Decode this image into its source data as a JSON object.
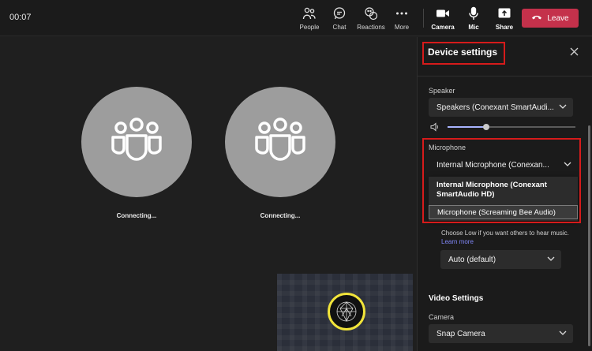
{
  "topbar": {
    "timer": "00:07",
    "people_label": "People",
    "chat_label": "Chat",
    "reactions_label": "Reactions",
    "more_label": "More",
    "camera_label": "Camera",
    "mic_label": "Mic",
    "share_label": "Share",
    "leave_label": "Leave"
  },
  "stage": {
    "participants": [
      {
        "status": "Connecting..."
      },
      {
        "status": "Connecting..."
      }
    ]
  },
  "panel": {
    "title": "Device settings",
    "speaker_label": "Speaker",
    "speaker_value": "Speakers (Conexant SmartAudi...",
    "volume_level_percent": 30,
    "microphone_label": "Microphone",
    "microphone_value": "Internal Microphone (Conexan...",
    "mic_options": [
      "Internal Microphone (Conexant SmartAudio HD)",
      "Microphone (Screaming Bee Audio)"
    ],
    "noise_note": "Choose Low if you want others to hear music.",
    "learn_more": "Learn more",
    "noise_value": "Auto (default)",
    "video_heading": "Video Settings",
    "camera_label": "Camera",
    "camera_value": "Snap Camera"
  },
  "colors": {
    "leave": "#c4314b",
    "highlight": "#d61b1b",
    "link": "#7f85f5",
    "avatar_ring": "#f1e43a"
  }
}
